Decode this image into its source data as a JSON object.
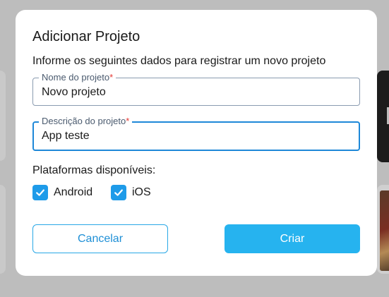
{
  "modal": {
    "title": "Adicionar Projeto",
    "subtitle": "Informe os seguintes dados para registrar um novo projeto"
  },
  "fields": {
    "name": {
      "label": "Nome do projeto",
      "required_mark": "*",
      "value": "Novo projeto"
    },
    "description": {
      "label": "Descrição do projeto",
      "required_mark": "*",
      "value": "App teste"
    }
  },
  "platforms": {
    "label": "Plataformas disponíveis:",
    "options": [
      {
        "label": "Android",
        "checked": true
      },
      {
        "label": "iOS",
        "checked": true
      }
    ]
  },
  "actions": {
    "cancel_label": "Cancelar",
    "create_label": "Criar"
  },
  "colors": {
    "accent": "#26b3ef",
    "checkbox": "#1e9be9",
    "focus_border": "#1e88d8",
    "required": "#e53935"
  },
  "icons": {
    "checkbox_check": "check-icon"
  }
}
